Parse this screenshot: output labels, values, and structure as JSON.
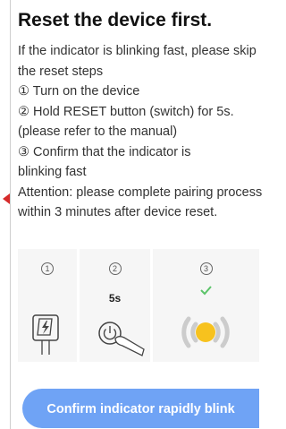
{
  "title": "Reset the device first.",
  "instructions": [
    "If the indicator is blinking fast, please skip",
    "the reset steps",
    "① Turn on the device",
    "② Hold RESET button (switch) for 5s.",
    "(please refer to the manual)",
    "③ Confirm that the indicator is",
    "blinking fast",
    "Attention: please complete pairing process",
    "within 3 minutes after device reset."
  ],
  "steps": [
    {
      "number": "1",
      "label": "",
      "icon": "power-plug-icon"
    },
    {
      "number": "2",
      "label": "5s",
      "icon": "power-button-press-icon"
    },
    {
      "number": "3",
      "label": "",
      "icon": "blinking-indicator-icon"
    }
  ],
  "confirm_button": "Confirm indicator rapidly blink",
  "colors": {
    "accent": "#6fa3f5",
    "check": "#5cc46a",
    "indicator": "#f7c21e",
    "marker": "#d62a2a"
  }
}
